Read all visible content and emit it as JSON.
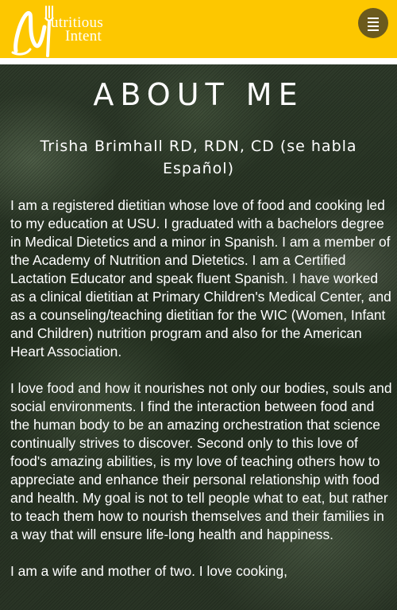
{
  "header": {
    "logo_line1": "utritious",
    "logo_line2": "Intent",
    "menu_icon": "hamburger-menu-icon",
    "brand_color": "#fdc700"
  },
  "main": {
    "title": "ABOUT ME",
    "subtitle": "Trisha Brimhall RD, RDN, CD (se habla Español)",
    "paragraphs": [
      "I am a registered dietitian whose love of food and cooking led to my education at USU. I graduated with a bachelors degree in Medical Dietetics and a minor in Spanish. I am a member of the Academy of Nutrition and Dietetics. I am a Certified Lactation Educator and speak fluent Spanish. I have worked as a clinical dietitian at Primary Children's Medical Center, and as a counseling/teaching dietitian for the WIC (Women, Infant and Children) nutrition program and also for the American Heart Association.",
      "I love food and how it nourishes not only our bodies, souls and social environments. I find the interaction between food and the human body to be an amazing orchestration that science continually strives to discover. Second only to this love of food's amazing abilities, is my love of teaching others how to appreciate and enhance their personal relationship with food and health. My goal is not to tell people what to eat, but rather to teach them how to nourish themselves and their families in a way that will ensure life-long health and happiness.",
      "I am a wife and mother of two. I love cooking,"
    ]
  }
}
